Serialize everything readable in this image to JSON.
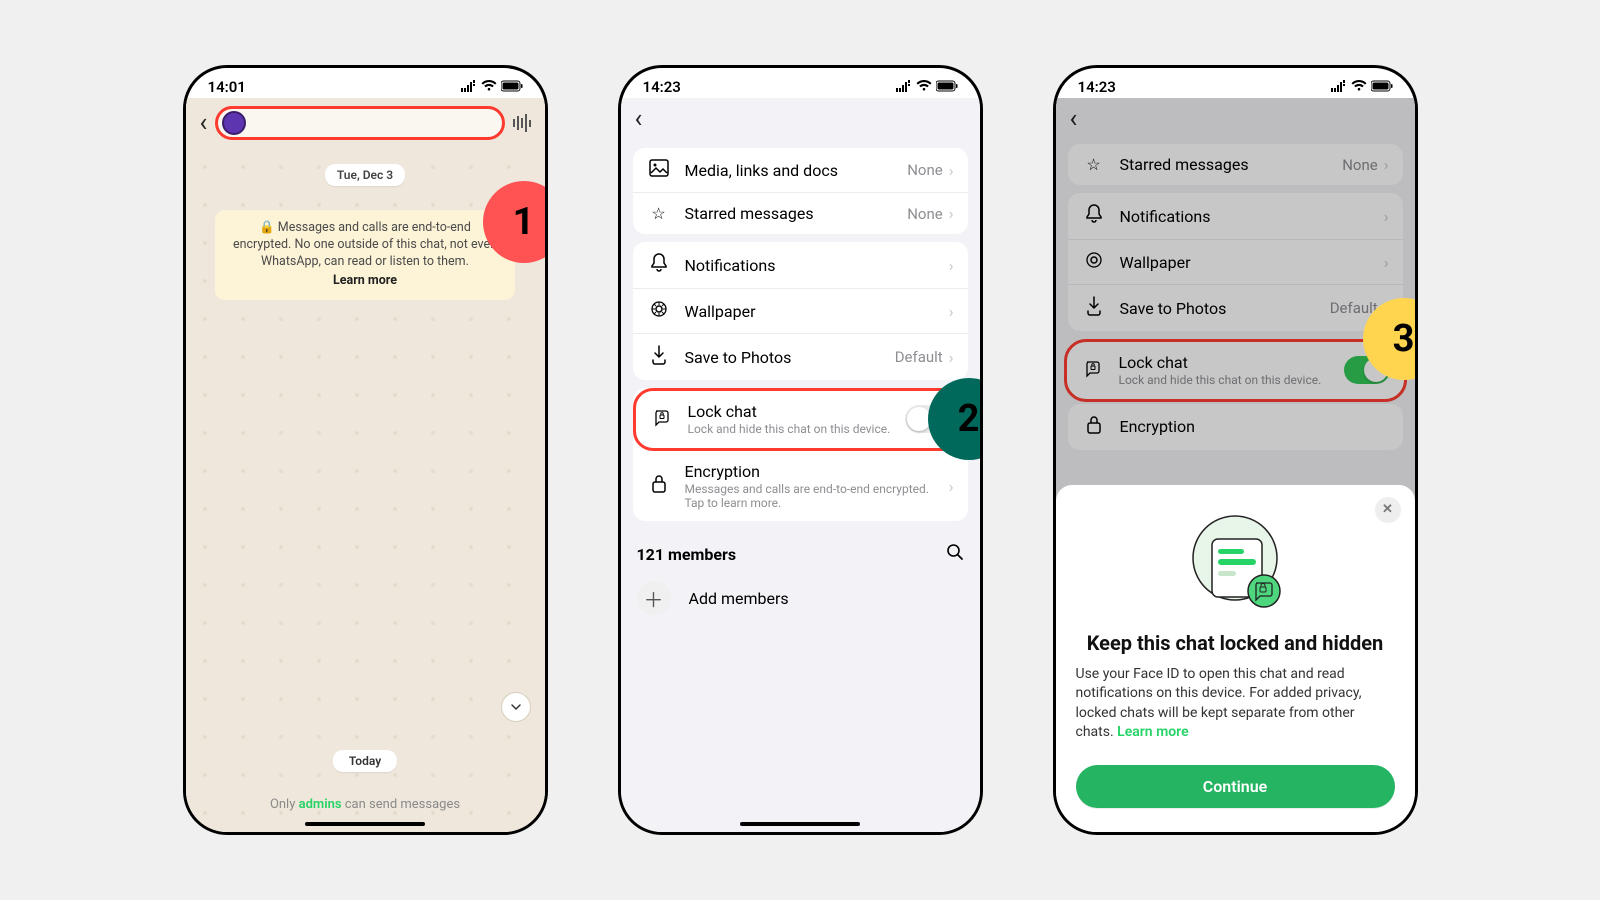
{
  "phone1": {
    "time": "14:01",
    "date_pill": "Tue, Dec 3",
    "encryption_note": "Messages and calls are end-to-end encrypted. No one outside of this chat, not even WhatsApp, can read or listen to them.",
    "learn_more": "Learn more",
    "today": "Today",
    "footer_pre": "Only ",
    "footer_admins": "admins",
    "footer_post": " can send messages",
    "step_label": "1"
  },
  "phone2": {
    "time": "14:23",
    "rows": {
      "media": {
        "label": "Media, links and docs",
        "value": "None"
      },
      "starred": {
        "label": "Starred messages",
        "value": "None"
      },
      "notifications": {
        "label": "Notifications"
      },
      "wallpaper": {
        "label": "Wallpaper"
      },
      "save_photos": {
        "label": "Save to Photos",
        "value": "Default"
      },
      "lock_chat": {
        "label": "Lock chat",
        "sub": "Lock and hide this chat on this device."
      },
      "encryption": {
        "label": "Encryption",
        "sub": "Messages and calls are end-to-end encrypted. Tap to learn more."
      }
    },
    "members_count": "121 members",
    "add_members": "Add members",
    "step_label": "2"
  },
  "phone3": {
    "time": "14:23",
    "rows": {
      "starred": {
        "label": "Starred messages",
        "value": "None"
      },
      "notifications": {
        "label": "Notifications"
      },
      "wallpaper": {
        "label": "Wallpaper"
      },
      "save_photos": {
        "label": "Save to Photos",
        "value": "Default"
      },
      "lock_chat": {
        "label": "Lock chat",
        "sub": "Lock and hide this chat on this device."
      },
      "encryption": {
        "label": "Encryption"
      }
    },
    "step_label": "3",
    "sheet": {
      "title": "Keep this chat locked and hidden",
      "body": "Use your Face ID to open this chat and read notifications on this device. For added privacy, locked chats will be kept separate from other chats. ",
      "learn_more": "Learn more",
      "continue": "Continue"
    }
  }
}
